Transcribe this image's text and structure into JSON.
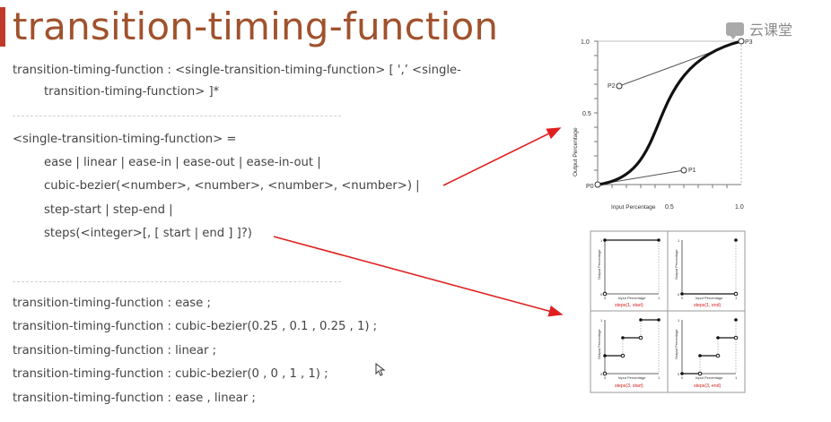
{
  "header": {
    "title": "transition-timing-function",
    "logo_text": "云课堂",
    "accent_color": "#c0392b"
  },
  "syntax": {
    "line1": "transition-timing-function : <single-transition-timing-function> [   ',’    <single-",
    "line2": "transition-timing-function> ]*"
  },
  "definition": {
    "head": "<single-transition-timing-function> =",
    "lines": [
      "ease | linear | ease-in | ease-out | ease-in-out |",
      "cubic-bezier(<number>, <number>, <number>, <number>) |",
      "step-start | step-end |",
      "steps(<integer>[, [ start | end ] ]?)"
    ]
  },
  "examples": [
    "transition-timing-function : ease ;",
    "transition-timing-function : cubic-bezier(0.25 , 0.1 , 0.25 , 1) ;",
    "transition-timing-function : linear ;",
    "transition-timing-function : cubic-bezier(0 , 0 , 1 , 1) ;",
    "transition-timing-function : ease , linear ;"
  ],
  "bezier_diagram": {
    "ylabel": "Output Percentage",
    "xlabel": "Input Percentage",
    "x_ticks": [
      "0.5",
      "1.0"
    ],
    "y_ticks": [
      "1.0",
      "0.5"
    ],
    "points": {
      "p0": "P0",
      "p1": "P1",
      "p2": "P2",
      "p3": "P3"
    }
  },
  "steps_diagram": {
    "ylabel": "Output Percentage",
    "xlabel": "Input Percentage",
    "tick_0": "0",
    "tick_1": "1",
    "panels": [
      {
        "caption": "steps(1, start)"
      },
      {
        "caption": "steps(1, end)"
      },
      {
        "caption": "steps(3, start)"
      },
      {
        "caption": "steps(3, end)"
      }
    ]
  }
}
